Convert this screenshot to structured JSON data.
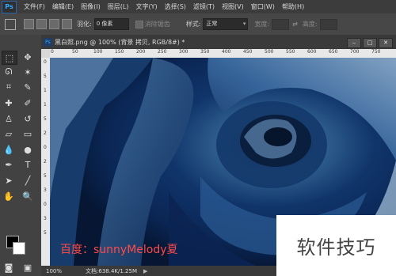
{
  "app": {
    "logo": "Ps"
  },
  "menu": [
    "文件(F)",
    "编辑(E)",
    "图像(I)",
    "图层(L)",
    "文字(Y)",
    "选择(S)",
    "滤镜(T)",
    "视图(V)",
    "窗口(W)",
    "帮助(H)"
  ],
  "options": {
    "feather_label": "羽化:",
    "feather_value": "0 像素",
    "antialias_label": "消除锯齿",
    "style_label": "样式:",
    "style_value": "正常",
    "width_label": "宽度:",
    "height_label": "高度:"
  },
  "document": {
    "tab_title": "黑白照.png @ 100% (背景 拷贝, RGB/8#) *",
    "ps_badge": "Ps",
    "ruler_ticks": [
      "0",
      "50",
      "100",
      "150",
      "200",
      "250",
      "300",
      "350",
      "400",
      "450",
      "500",
      "550",
      "600",
      "650",
      "700",
      "750"
    ],
    "ruler_v_ticks": [
      "0",
      "5",
      "1",
      "1",
      "5",
      "2",
      "0",
      "2",
      "5",
      "3",
      "0",
      "3",
      "5"
    ],
    "watermark_text": "百度：sunnyMelody夏",
    "zoom": "100%",
    "doc_info": "文档:638.4K/1.25M"
  },
  "site_watermark": "软件技巧",
  "colors": {
    "foreground": "#000000",
    "background": "#ffffff",
    "accent": "#31a8ff"
  }
}
